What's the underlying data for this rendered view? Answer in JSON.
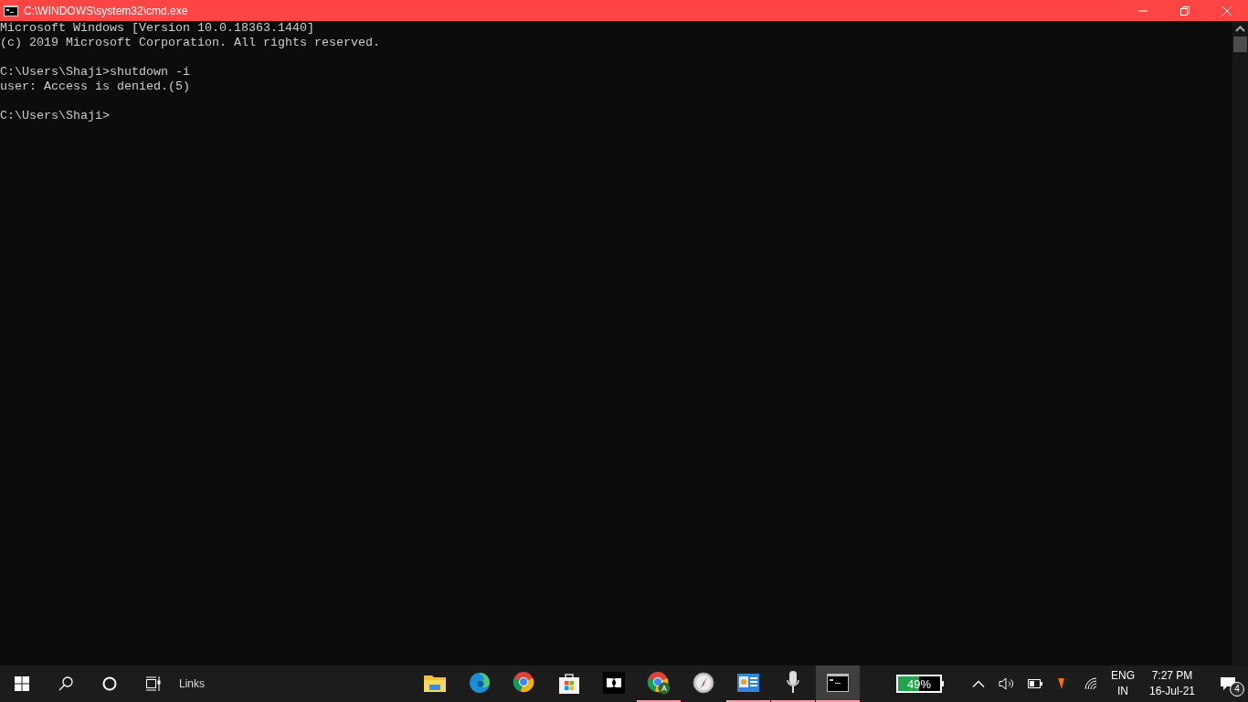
{
  "window": {
    "title": "C:\\WINDOWS\\system32\\cmd.exe"
  },
  "console": {
    "blocks": [
      [
        "Microsoft Windows [Version 10.0.18363.1440]",
        "(c) 2019 Microsoft Corporation. All rights reserved."
      ],
      [
        "C:\\Users\\Shaji>shutdown -i",
        "user: Access is denied.(5)"
      ],
      [
        "C:\\Users\\Shaji>"
      ]
    ]
  },
  "taskbar": {
    "links_label": "Links",
    "apps": [
      {
        "kind": "folder",
        "running": false,
        "active": false
      },
      {
        "kind": "edge",
        "running": false,
        "active": false
      },
      {
        "kind": "chrome",
        "running": false,
        "active": false
      },
      {
        "kind": "store",
        "running": false,
        "active": false
      },
      {
        "kind": "dolby",
        "running": false,
        "active": false
      },
      {
        "kind": "chrome-profile",
        "running": true,
        "active": false
      },
      {
        "kind": "compass",
        "running": false,
        "active": false
      },
      {
        "kind": "panel",
        "running": true,
        "active": false
      },
      {
        "kind": "mic",
        "running": true,
        "active": false
      },
      {
        "kind": "console",
        "running": true,
        "active": true
      }
    ],
    "battery_widget": {
      "level": 0.49,
      "text": "49%"
    },
    "language": {
      "top": "ENG",
      "bottom": "IN"
    },
    "clock": {
      "time": "7:27 PM",
      "date": "16-Jul-21"
    },
    "notifications": {
      "count": "4"
    }
  }
}
